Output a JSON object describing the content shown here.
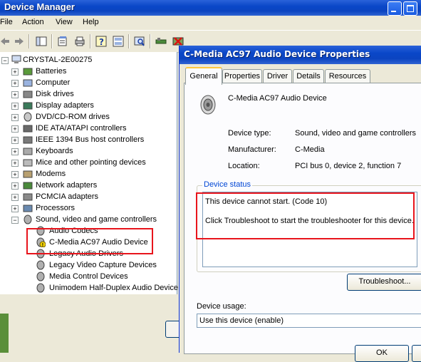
{
  "device_manager": {
    "title": "Device Manager",
    "menu": [
      "File",
      "Action",
      "View",
      "Help"
    ],
    "root": "CRYSTAL-2E00275",
    "categories": [
      {
        "label": "Batteries",
        "icon": "battery-icon"
      },
      {
        "label": "Computer",
        "icon": "computer-icon"
      },
      {
        "label": "Disk drives",
        "icon": "disk-drive-icon"
      },
      {
        "label": "Display adapters",
        "icon": "display-adapter-icon"
      },
      {
        "label": "DVD/CD-ROM drives",
        "icon": "cdrom-icon"
      },
      {
        "label": "IDE ATA/ATAPI controllers",
        "icon": "ide-controller-icon"
      },
      {
        "label": "IEEE 1394 Bus host controllers",
        "icon": "ieee1394-icon"
      },
      {
        "label": "Keyboards",
        "icon": "keyboard-icon"
      },
      {
        "label": "Mice and other pointing devices",
        "icon": "mouse-icon"
      },
      {
        "label": "Modems",
        "icon": "modem-icon"
      },
      {
        "label": "Network adapters",
        "icon": "network-adapter-icon"
      },
      {
        "label": "PCMCIA adapters",
        "icon": "pcmcia-icon"
      },
      {
        "label": "Processors",
        "icon": "processor-icon"
      },
      {
        "label": "Sound, video and game controllers",
        "icon": "speaker-icon"
      }
    ],
    "sound_children": [
      {
        "label": "Audio Codecs",
        "icon": "speaker-icon",
        "warning": false
      },
      {
        "label": "C-Media AC97 Audio Device",
        "icon": "speaker-warning-icon",
        "warning": true
      },
      {
        "label": "Legacy Audio Drivers",
        "icon": "speaker-icon",
        "warning": false
      },
      {
        "label": "Legacy Video Capture Devices",
        "icon": "speaker-icon",
        "warning": false
      },
      {
        "label": "Media Control Devices",
        "icon": "speaker-icon",
        "warning": false
      },
      {
        "label": "Unimodem Half-Duplex Audio Device",
        "icon": "speaker-icon",
        "warning": false
      }
    ]
  },
  "properties": {
    "title": "C-Media AC97 Audio Device Properties",
    "tabs": [
      "General",
      "Properties",
      "Driver",
      "Details",
      "Resources"
    ],
    "active_tab": "General",
    "device_name": "C-Media AC97 Audio Device",
    "device_type_label": "Device type:",
    "device_type_value": "Sound, video and game controllers",
    "manufacturer_label": "Manufacturer:",
    "manufacturer_value": "C-Media",
    "location_label": "Location:",
    "location_value": "PCI bus 0, device 2, function 7",
    "status_legend": "Device status",
    "status_line1": "This device cannot start. (Code 10)",
    "status_line2": "Click Troubleshoot to start the troubleshooter for this device.",
    "troubleshoot_label": "Troubleshoot...",
    "usage_label": "Device usage:",
    "usage_value": "Use this device (enable)",
    "ok_label": "OK"
  },
  "colors": {
    "highlight": "#e8141c",
    "title_bar": "#0a47c8",
    "legend": "#0046d5"
  }
}
